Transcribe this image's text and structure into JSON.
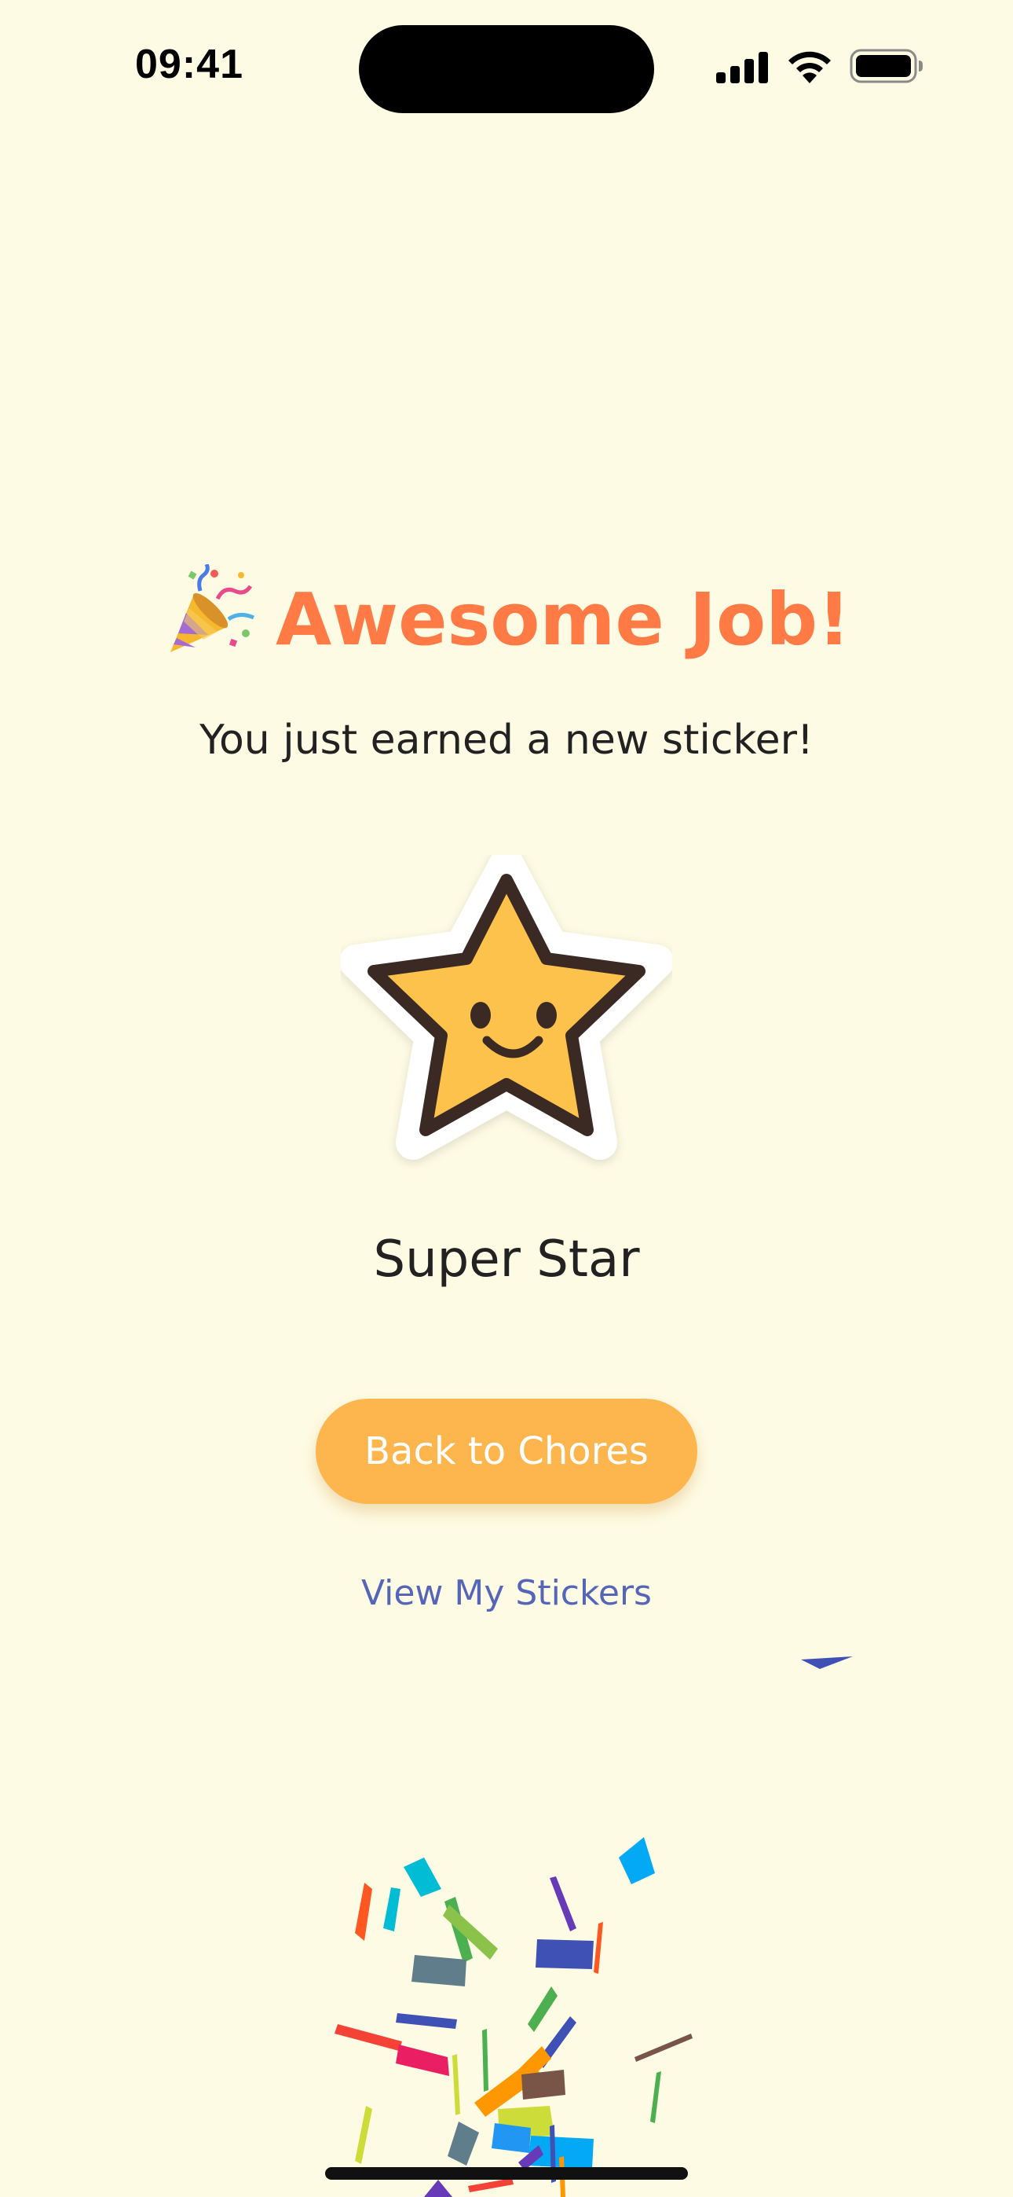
{
  "status_bar": {
    "time": "09:41",
    "icons": [
      "cellular-signal-icon",
      "wifi-icon",
      "battery-icon"
    ]
  },
  "celebration": {
    "title": "Awesome Job!",
    "title_icon": "party-popper-icon",
    "subtitle": "You just earned a new sticker!",
    "sticker": {
      "icon": "smiling-star-sticker",
      "name": "Super Star"
    }
  },
  "actions": {
    "primary_label": "Back to Chores",
    "secondary_label": "View My Stickers"
  },
  "decoration": {
    "effect": "confetti"
  },
  "colors": {
    "background": "#FEFBE4",
    "title": "#FF7A45",
    "button": "#FDB54E",
    "link": "#5566B8",
    "star": "#FCC24C"
  }
}
